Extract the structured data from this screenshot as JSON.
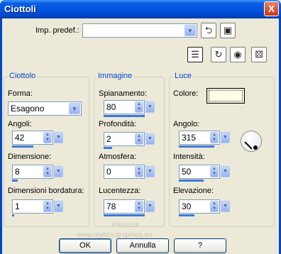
{
  "window": {
    "title": "Ciottoli",
    "close_label": "X"
  },
  "presets": {
    "label": "Imp. predef.:",
    "value": ""
  },
  "groups": {
    "ciottolo": {
      "title": "Ciottolo",
      "forma_label": "Forma:",
      "forma_value": "Esagono",
      "angoli_label": "Angoli:",
      "angoli_value": "42",
      "dimensione_label": "Dimensione:",
      "dimensione_value": "8",
      "bordatura_label": "Dimensioni bordatura:",
      "bordatura_value": "1"
    },
    "immagine": {
      "title": "Immagine",
      "spianamento_label": "Spianamento:",
      "spianamento_value": "80",
      "profondita_label": "Profondità:",
      "profondita_value": "2",
      "atmosfera_label": "Atmosfera:",
      "atmosfera_value": "0",
      "lucentezza_label": "Lucentezza:",
      "lucentezza_value": "78"
    },
    "luce": {
      "title": "Luce",
      "colore_label": "Colore:",
      "colore_value": "#fffde6",
      "angolo_label": "Angolo:",
      "angolo_value": "315",
      "intensita_label": "Intensità:",
      "intensita_value": "50",
      "elevazione_label": "Elevazione:",
      "elevazione_value": "30"
    }
  },
  "buttons": {
    "ok": "OK",
    "cancel": "Annulla",
    "help": "?"
  },
  "watermark": {
    "line1": "Pinuccia",
    "line2": "www.mytiny.graphics.eu"
  },
  "colors": {
    "title_bar": "#0054e3",
    "group_title": "#0046d5",
    "dialog_bg": "#ece9d8"
  },
  "icons": [
    "reset-icon",
    "save-icon",
    "randomize-icon",
    "preview-toggle-icon",
    "eye-icon",
    "dice-icon"
  ]
}
